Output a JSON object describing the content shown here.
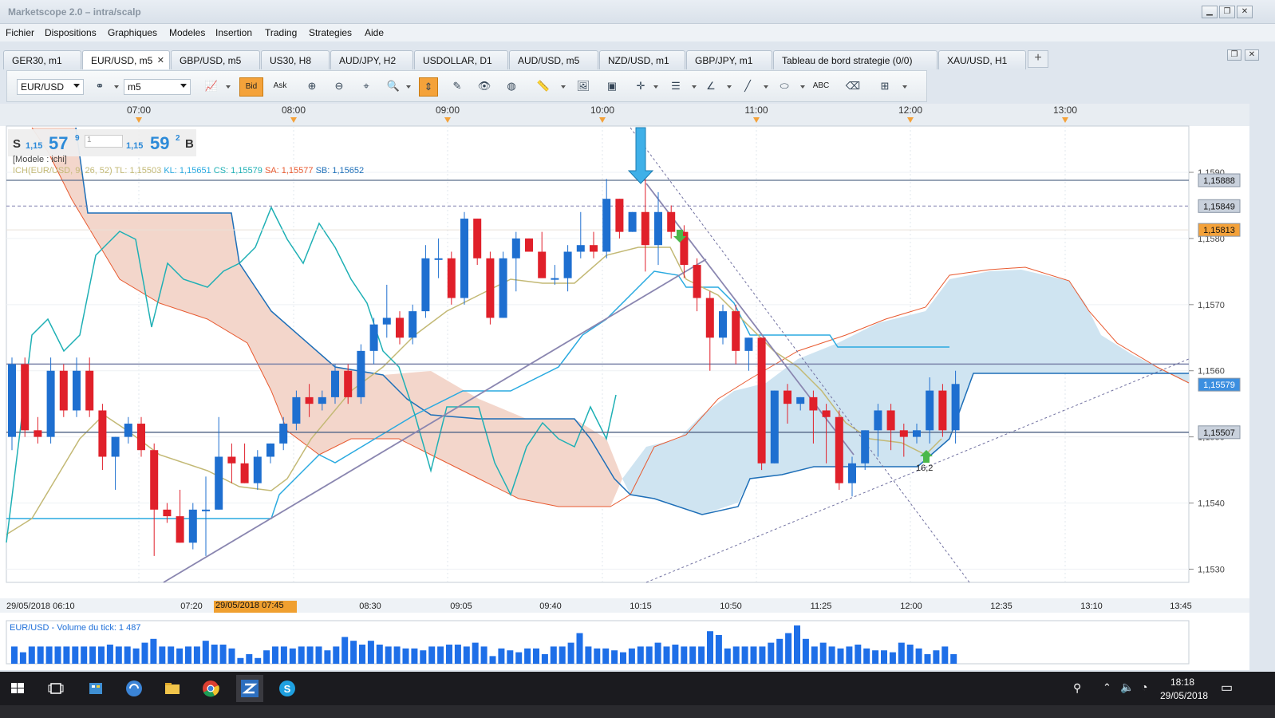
{
  "window": {
    "title": "Marketscope 2.0 – intra/scalp",
    "controls": [
      "minimize",
      "restore",
      "close"
    ]
  },
  "menu": [
    "Fichier",
    "Dispositions",
    "Graphiques",
    "Modeles",
    "Insertion",
    "Trading",
    "Strategies",
    "Aide"
  ],
  "tabs": [
    {
      "label": "GER30, m1",
      "active": false
    },
    {
      "label": "EUR/USD, m5",
      "active": true
    },
    {
      "label": "GBP/USD, m5",
      "active": false
    },
    {
      "label": "US30, H8",
      "active": false
    },
    {
      "label": "AUD/JPY, H2",
      "active": false
    },
    {
      "label": "USDOLLAR, D1",
      "active": false
    },
    {
      "label": "AUD/USD, m5",
      "active": false
    },
    {
      "label": "NZD/USD, m1",
      "active": false
    },
    {
      "label": "GBP/JPY, m1",
      "active": false
    },
    {
      "label": "Tableau de bord strategie (0/0)",
      "active": false
    },
    {
      "label": "XAU/USD, H1",
      "active": false
    }
  ],
  "toolbar": {
    "symbol": "EUR/USD",
    "timeframe": "m5",
    "bid_label": "Bid",
    "ask_label": "Ask"
  },
  "quote": {
    "sell_label": "S",
    "sell_prefix": "1,15",
    "sell_big": "57",
    "sell_sup": "9",
    "qty": "1",
    "buy_prefix": "1,15",
    "buy_big": "59",
    "buy_sup": "2",
    "buy_label": "B"
  },
  "model_label": "[Modele : ichi]",
  "ichimoku": {
    "name": "ICH(EUR/USD, 9, 26, 52)",
    "tl": "TL: 1,15503",
    "kl": "KL: 1,15651",
    "cs": "CS: 1,15579",
    "sa": "SA: 1,15577",
    "sb": "SB: 1,15652"
  },
  "volume_label": "EUR/USD - Volume du tick: 1 487",
  "date_marker": "29/05/2018 07:45",
  "taskbar": {
    "time": "18:18",
    "date": "29/05/2018"
  },
  "colors": {
    "up_candle": "#1e6fd0",
    "down_candle": "#e0202a",
    "cloud_bear": "#f3d6cb",
    "cloud_bull": "#cfe4f1",
    "tenkan": "#c3b975",
    "kijun": "#2aaae0",
    "chikou": "#1fb0b5",
    "senkou_a": "#e85a30",
    "senkou_b": "#1e6fb8",
    "accent": "#f4a23a"
  },
  "chart_data": {
    "type": "candlestick",
    "symbol": "EUR/USD",
    "timeframe": "m5",
    "y_ticks": [
      "1,1590",
      "1,1580",
      "1,1570",
      "1,1560",
      "1,1550",
      "1,1540",
      "1,1530"
    ],
    "ylim": [
      1.1528,
      1.1597
    ],
    "price_labels": [
      {
        "value": 1.15888,
        "text": "1,15888"
      },
      {
        "value": 1.15849,
        "text": "1,15849"
      },
      {
        "value": 1.15813,
        "text": "1,15813"
      },
      {
        "value": 1.15579,
        "text": "1,15579"
      },
      {
        "value": 1.15507,
        "text": "1,15507"
      }
    ],
    "top_time_axis": [
      "07:00",
      "08:00",
      "09:00",
      "10:00",
      "11:00",
      "12:00",
      "13:00"
    ],
    "bottom_time_axis": [
      "29/05/2018 06:10",
      "07:20",
      "08:30",
      "09:05",
      "09:40",
      "10:15",
      "10:50",
      "11:25",
      "12:00",
      "12:35",
      "13:10",
      "13:45"
    ],
    "candles": [
      {
        "o": 1.155,
        "h": 1.1562,
        "l": 1.1548,
        "c": 1.1561
      },
      {
        "o": 1.1561,
        "h": 1.1562,
        "l": 1.155,
        "c": 1.1551
      },
      {
        "o": 1.1551,
        "h": 1.1553,
        "l": 1.1549,
        "c": 1.155
      },
      {
        "o": 1.155,
        "h": 1.1562,
        "l": 1.1549,
        "c": 1.156
      },
      {
        "o": 1.156,
        "h": 1.1561,
        "l": 1.1553,
        "c": 1.1554
      },
      {
        "o": 1.1554,
        "h": 1.1562,
        "l": 1.1553,
        "c": 1.156
      },
      {
        "o": 1.156,
        "h": 1.1562,
        "l": 1.1553,
        "c": 1.1554
      },
      {
        "o": 1.1554,
        "h": 1.1555,
        "l": 1.1545,
        "c": 1.1547
      },
      {
        "o": 1.1547,
        "h": 1.155,
        "l": 1.1542,
        "c": 1.155
      },
      {
        "o": 1.155,
        "h": 1.1553,
        "l": 1.1549,
        "c": 1.1552
      },
      {
        "o": 1.1552,
        "h": 1.1553,
        "l": 1.1547,
        "c": 1.1548
      },
      {
        "o": 1.1548,
        "h": 1.1549,
        "l": 1.1532,
        "c": 1.1539
      },
      {
        "o": 1.1539,
        "h": 1.154,
        "l": 1.1537,
        "c": 1.1538
      },
      {
        "o": 1.1538,
        "h": 1.1542,
        "l": 1.1534,
        "c": 1.1534
      },
      {
        "o": 1.1534,
        "h": 1.154,
        "l": 1.1533,
        "c": 1.1539
      },
      {
        "o": 1.1539,
        "h": 1.1544,
        "l": 1.1532,
        "c": 1.1539
      },
      {
        "o": 1.1539,
        "h": 1.1553,
        "l": 1.1539,
        "c": 1.1547
      },
      {
        "o": 1.1547,
        "h": 1.1549,
        "l": 1.1543,
        "c": 1.1546
      },
      {
        "o": 1.1546,
        "h": 1.1549,
        "l": 1.1543,
        "c": 1.1543
      },
      {
        "o": 1.1543,
        "h": 1.1548,
        "l": 1.1542,
        "c": 1.1547
      },
      {
        "o": 1.1547,
        "h": 1.1549,
        "l": 1.1546,
        "c": 1.1549
      },
      {
        "o": 1.1549,
        "h": 1.1553,
        "l": 1.1548,
        "c": 1.1552
      },
      {
        "o": 1.1552,
        "h": 1.1557,
        "l": 1.1551,
        "c": 1.1556
      },
      {
        "o": 1.1556,
        "h": 1.1558,
        "l": 1.1553,
        "c": 1.1555
      },
      {
        "o": 1.1555,
        "h": 1.1557,
        "l": 1.1554,
        "c": 1.1556
      },
      {
        "o": 1.1556,
        "h": 1.1561,
        "l": 1.1555,
        "c": 1.156
      },
      {
        "o": 1.156,
        "h": 1.1561,
        "l": 1.1555,
        "c": 1.1556
      },
      {
        "o": 1.1556,
        "h": 1.1564,
        "l": 1.1555,
        "c": 1.1563
      },
      {
        "o": 1.1563,
        "h": 1.1568,
        "l": 1.1561,
        "c": 1.1567
      },
      {
        "o": 1.1567,
        "h": 1.1573,
        "l": 1.1565,
        "c": 1.1568
      },
      {
        "o": 1.1568,
        "h": 1.1569,
        "l": 1.1564,
        "c": 1.1565
      },
      {
        "o": 1.1565,
        "h": 1.157,
        "l": 1.1564,
        "c": 1.1569
      },
      {
        "o": 1.1569,
        "h": 1.1579,
        "l": 1.1568,
        "c": 1.1577
      },
      {
        "o": 1.1577,
        "h": 1.158,
        "l": 1.1574,
        "c": 1.1577
      },
      {
        "o": 1.1577,
        "h": 1.1578,
        "l": 1.157,
        "c": 1.1571
      },
      {
        "o": 1.1571,
        "h": 1.1584,
        "l": 1.157,
        "c": 1.1583
      },
      {
        "o": 1.1583,
        "h": 1.1583,
        "l": 1.1576,
        "c": 1.1577
      },
      {
        "o": 1.1577,
        "h": 1.1578,
        "l": 1.1567,
        "c": 1.1568
      },
      {
        "o": 1.1568,
        "h": 1.1578,
        "l": 1.1568,
        "c": 1.1577
      },
      {
        "o": 1.1577,
        "h": 1.1581,
        "l": 1.1572,
        "c": 1.158
      },
      {
        "o": 1.158,
        "h": 1.158,
        "l": 1.1578,
        "c": 1.1578
      },
      {
        "o": 1.1578,
        "h": 1.1581,
        "l": 1.1575,
        "c": 1.1574
      },
      {
        "o": 1.1574,
        "h": 1.1576,
        "l": 1.1573,
        "c": 1.1574
      },
      {
        "o": 1.1574,
        "h": 1.1579,
        "l": 1.1572,
        "c": 1.1578
      },
      {
        "o": 1.1578,
        "h": 1.1584,
        "l": 1.1577,
        "c": 1.1579
      },
      {
        "o": 1.1579,
        "h": 1.1581,
        "l": 1.1577,
        "c": 1.1578
      },
      {
        "o": 1.1578,
        "h": 1.1589,
        "l": 1.1577,
        "c": 1.1586
      },
      {
        "o": 1.1586,
        "h": 1.1586,
        "l": 1.158,
        "c": 1.1581
      },
      {
        "o": 1.1581,
        "h": 1.1584,
        "l": 1.1581,
        "c": 1.1584
      },
      {
        "o": 1.1584,
        "h": 1.1589,
        "l": 1.1575,
        "c": 1.1579
      },
      {
        "o": 1.1579,
        "h": 1.1587,
        "l": 1.1576,
        "c": 1.1584
      },
      {
        "o": 1.1584,
        "h": 1.1585,
        "l": 1.158,
        "c": 1.1581
      },
      {
        "o": 1.1581,
        "h": 1.1582,
        "l": 1.1574,
        "c": 1.1576
      },
      {
        "o": 1.1576,
        "h": 1.1577,
        "l": 1.1569,
        "c": 1.1571
      },
      {
        "o": 1.1571,
        "h": 1.1572,
        "l": 1.156,
        "c": 1.1565
      },
      {
        "o": 1.1565,
        "h": 1.157,
        "l": 1.1564,
        "c": 1.1569
      },
      {
        "o": 1.1569,
        "h": 1.157,
        "l": 1.1561,
        "c": 1.1563
      },
      {
        "o": 1.1563,
        "h": 1.1565,
        "l": 1.156,
        "c": 1.1565
      },
      {
        "o": 1.1565,
        "h": 1.1565,
        "l": 1.1545,
        "c": 1.1546
      },
      {
        "o": 1.1546,
        "h": 1.1557,
        "l": 1.1546,
        "c": 1.1557
      },
      {
        "o": 1.1557,
        "h": 1.1558,
        "l": 1.1552,
        "c": 1.1555
      },
      {
        "o": 1.1555,
        "h": 1.1556,
        "l": 1.1554,
        "c": 1.1556
      },
      {
        "o": 1.1556,
        "h": 1.1557,
        "l": 1.1549,
        "c": 1.1554
      },
      {
        "o": 1.1554,
        "h": 1.1555,
        "l": 1.1546,
        "c": 1.1553
      },
      {
        "o": 1.1553,
        "h": 1.1554,
        "l": 1.1542,
        "c": 1.1543
      },
      {
        "o": 1.1543,
        "h": 1.1547,
        "l": 1.1541,
        "c": 1.1546
      },
      {
        "o": 1.1546,
        "h": 1.1551,
        "l": 1.1545,
        "c": 1.1551
      },
      {
        "o": 1.1551,
        "h": 1.1555,
        "l": 1.1547,
        "c": 1.1554
      },
      {
        "o": 1.1554,
        "h": 1.1555,
        "l": 1.1548,
        "c": 1.1551
      },
      {
        "o": 1.1551,
        "h": 1.1552,
        "l": 1.1547,
        "c": 1.155
      },
      {
        "o": 1.155,
        "h": 1.1552,
        "l": 1.1549,
        "c": 1.1551
      },
      {
        "o": 1.1551,
        "h": 1.1559,
        "l": 1.1549,
        "c": 1.1557
      },
      {
        "o": 1.1557,
        "h": 1.1558,
        "l": 1.155,
        "c": 1.1551
      },
      {
        "o": 1.1551,
        "h": 1.156,
        "l": 1.1549,
        "c": 1.1558
      }
    ],
    "volume": [
      9,
      6,
      9,
      9,
      9,
      9,
      9,
      9,
      9,
      9,
      9,
      10,
      9,
      9,
      8,
      11,
      13,
      9,
      9,
      8,
      9,
      9,
      12,
      10,
      10,
      8,
      3,
      5,
      3,
      7,
      9,
      9,
      8,
      9,
      9,
      9,
      7,
      9,
      14,
      12,
      10,
      12,
      10,
      9,
      9,
      8,
      8,
      7,
      9,
      9,
      10,
      10,
      9,
      11,
      9,
      4,
      8,
      7,
      6,
      8,
      8,
      5,
      9,
      9,
      11,
      16,
      9,
      8,
      8,
      7,
      6,
      8,
      9,
      9,
      11,
      9,
      10,
      9,
      9,
      9,
      17,
      15,
      8,
      9,
      9,
      9,
      9,
      11,
      13,
      16,
      20,
      13,
      9,
      11,
      9,
      8,
      9,
      10,
      8,
      7,
      7,
      6,
      11,
      10,
      8,
      5,
      7,
      9,
      5,
      5
    ]
  }
}
